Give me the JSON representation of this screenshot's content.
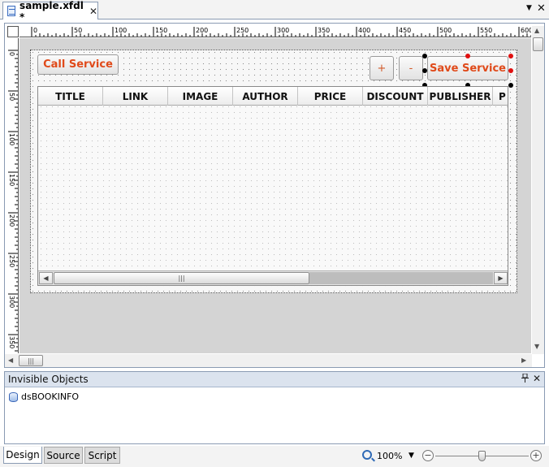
{
  "document_tab": {
    "label": "sample.xfdl *",
    "close_glyph": "✕"
  },
  "window_controls": {
    "dropdown_glyph": "▼",
    "close_glyph": "✕"
  },
  "ruler": {
    "horizontal_ticks": [
      "0",
      "50",
      "100",
      "150",
      "200",
      "250",
      "300",
      "350",
      "400",
      "450",
      "500",
      "550",
      "600"
    ],
    "vertical_ticks": [
      "0",
      "50",
      "100",
      "150",
      "200",
      "250",
      "300",
      "350"
    ]
  },
  "form": {
    "call_button": "Call Service",
    "plus_button": "+",
    "minus_button": "-",
    "save_button": "Save Service",
    "grid_columns": [
      "TITLE",
      "LINK",
      "IMAGE",
      "AUTHOR",
      "PRICE",
      "DISCOUNT",
      "PUBLISHER",
      "P"
    ],
    "grid_scroll_left": "◀",
    "grid_scroll_right": "▶",
    "grid_scroll_grip": "|||"
  },
  "scrollbars": {
    "up": "▲",
    "down": "▼",
    "left": "◀",
    "right": "▶",
    "grip": "|||"
  },
  "invisible_objects": {
    "title": "Invisible Objects",
    "pin_glyph": "📌",
    "close_glyph": "✕",
    "items": [
      "dsBOOKINFO"
    ]
  },
  "view_tabs": {
    "design": "Design",
    "source": "Source",
    "script": "Script"
  },
  "zoom": {
    "value": "100%",
    "dropdown_glyph": "▼",
    "minus": "−",
    "plus": "+",
    "level_fraction": 0.5
  },
  "icons": {
    "document": "document-icon",
    "dataset": "dataset-icon",
    "zoom": "magnifier-icon"
  },
  "colors": {
    "accent_text": "#e04a1a",
    "selection_handle": "#e01010",
    "panel_header": "#dbe3ee"
  }
}
